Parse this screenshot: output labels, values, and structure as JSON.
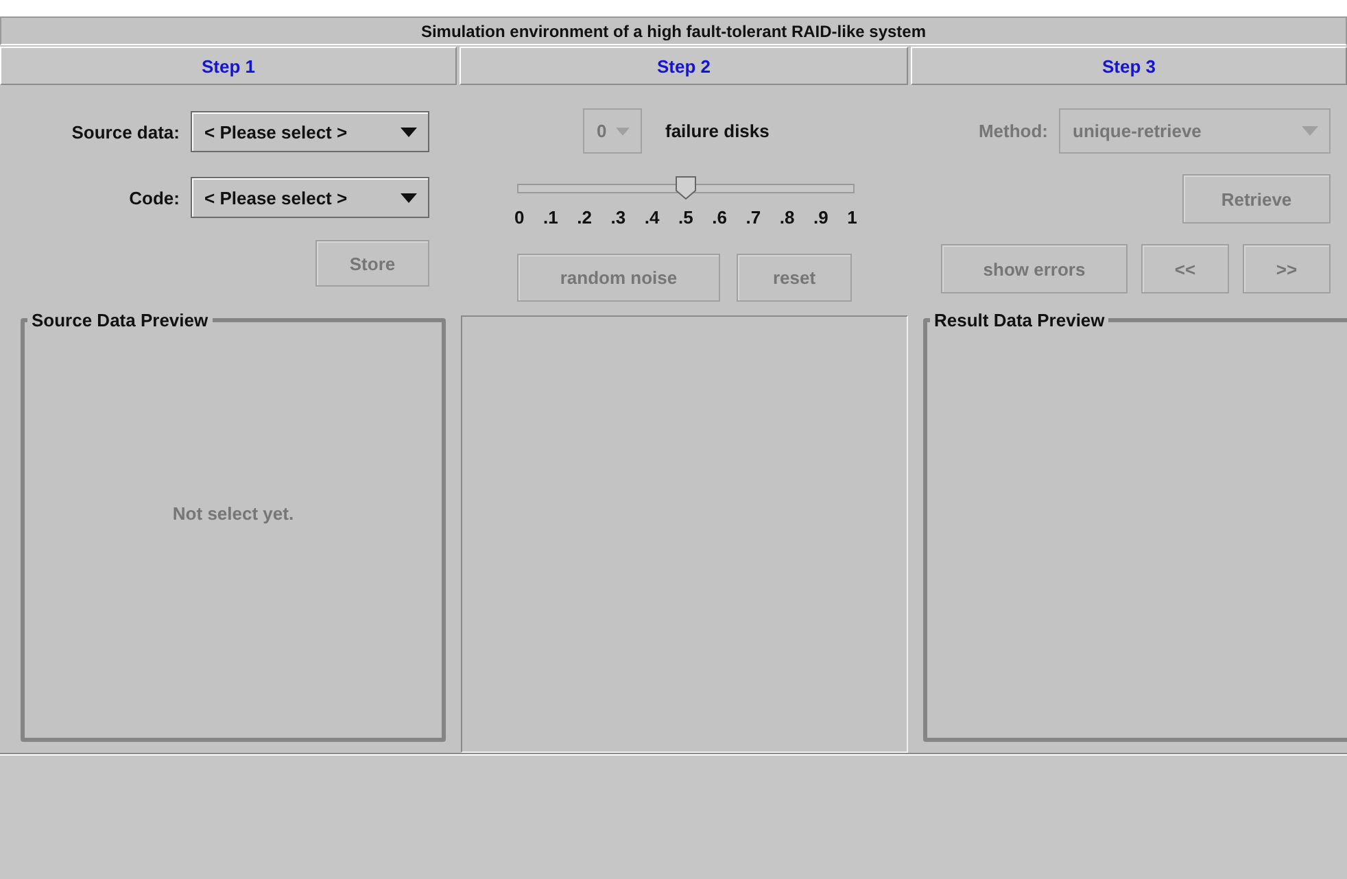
{
  "title": "Simulation environment of a high fault-tolerant RAID-like system",
  "steps": [
    {
      "label": "Step 1"
    },
    {
      "label": "Step 2"
    },
    {
      "label": "Step 3"
    }
  ],
  "step1": {
    "fields": [
      {
        "label": "Source data:",
        "value": "< Please select >",
        "disabled": false
      },
      {
        "label": "Code:",
        "value": "< Please select >",
        "disabled": false
      }
    ],
    "store_button": {
      "label": "Store",
      "disabled": true
    }
  },
  "step2": {
    "failure_count": {
      "value": "0",
      "disabled": true
    },
    "failure_label": "failure disks",
    "slider": {
      "level": 0.5,
      "ticks": [
        "0",
        ".1",
        ".2",
        ".3",
        ".4",
        ".5",
        ".6",
        ".7",
        ".8",
        ".9",
        "1"
      ]
    },
    "buttons": [
      {
        "label": "random noise",
        "disabled": true
      },
      {
        "label": "reset",
        "disabled": true
      }
    ]
  },
  "step3": {
    "method": {
      "label": "Method:",
      "value": "unique-retrieve",
      "disabled": true
    },
    "retrieve_button": {
      "label": "Retrieve",
      "disabled": true
    },
    "buttons": [
      {
        "label": "show errors",
        "disabled": true
      },
      {
        "label": "<<",
        "disabled": true
      },
      {
        "label": ">>",
        "disabled": true
      }
    ]
  },
  "panels": {
    "source": {
      "title": "Source Data Preview",
      "message": "Not select yet."
    },
    "result": {
      "title": "Result Data Preview"
    }
  }
}
